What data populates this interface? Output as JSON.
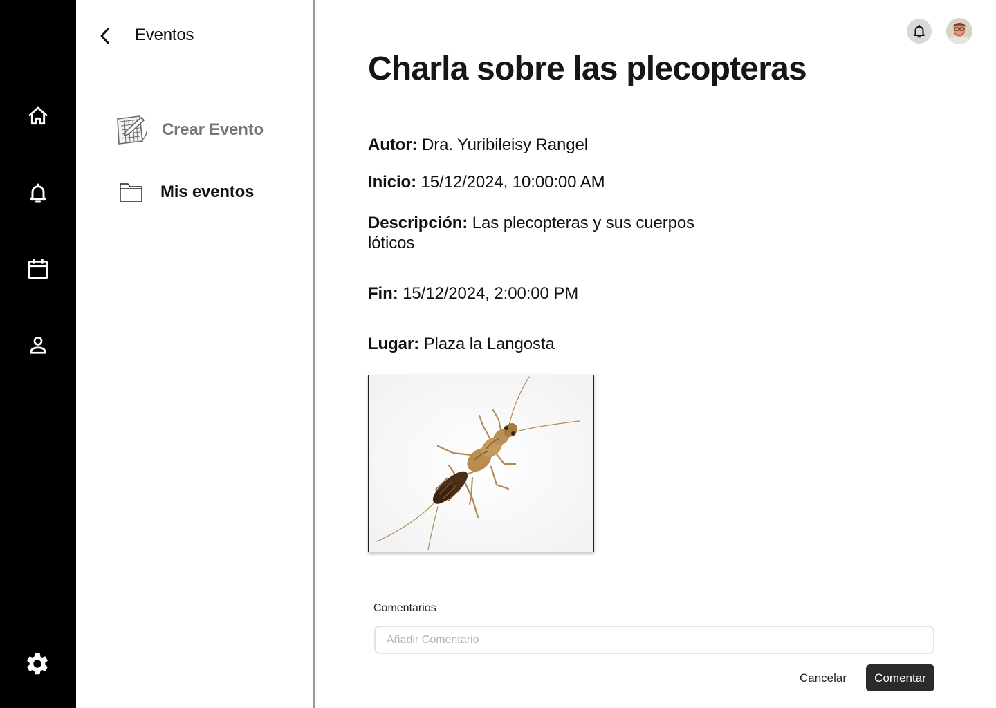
{
  "rail": {
    "items": [
      {
        "icon": "home-icon"
      },
      {
        "icon": "bell-icon"
      },
      {
        "icon": "calendar-icon"
      },
      {
        "icon": "user-icon"
      }
    ],
    "settings_icon": "gear-icon"
  },
  "subnav": {
    "title": "Eventos",
    "items": [
      {
        "label": "Crear Evento",
        "icon": "create-event-icon"
      },
      {
        "label": "Mis eventos",
        "icon": "folder-icon"
      }
    ]
  },
  "event": {
    "title": "Charla sobre las plecopteras",
    "author_label": "Autor:",
    "author": "Dra. Yuribileisy Rangel",
    "start_label": "Inicio:",
    "start": "15/12/2024, 10:00:00 AM",
    "description_label": "Descripción:",
    "description": "Las plecopteras y sus cuerpos lóticos",
    "end_label": "Fin:",
    "end": "15/12/2024, 2:00:00 PM",
    "place_label": "Lugar:",
    "place": "Plaza la Langosta"
  },
  "comments": {
    "label": "Comentarios",
    "placeholder": "Añadir Comentario",
    "value": "",
    "cancel_label": "Cancelar",
    "submit_label": "Comentar"
  },
  "colors": {
    "rail": "#000000",
    "primary_button": "#2b2b2b",
    "muted_text": "#777777"
  }
}
